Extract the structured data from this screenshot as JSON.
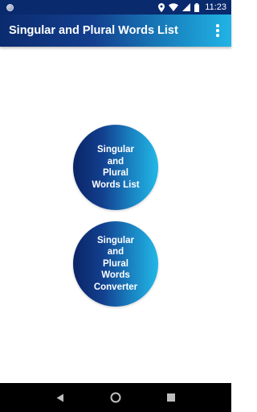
{
  "status_bar": {
    "time": "11:23",
    "icons": [
      "notification-icon",
      "location-icon",
      "wifi-icon",
      "signal-icon",
      "battery-icon"
    ]
  },
  "app_bar": {
    "title": "Singular and Plural Words List",
    "menu_icon": "overflow-menu-icon"
  },
  "buttons": [
    {
      "label": "Singular\nand\nPlural\nWords List"
    },
    {
      "label": "Singular\nand\nPlural\nWords\nConverter"
    }
  ],
  "nav_bar": {
    "icons": [
      "back-icon",
      "home-icon",
      "recents-icon"
    ]
  },
  "colors": {
    "status_bar": "#0a2a6e",
    "gradient_start": "#0b2466",
    "gradient_end": "#22b7e6"
  }
}
